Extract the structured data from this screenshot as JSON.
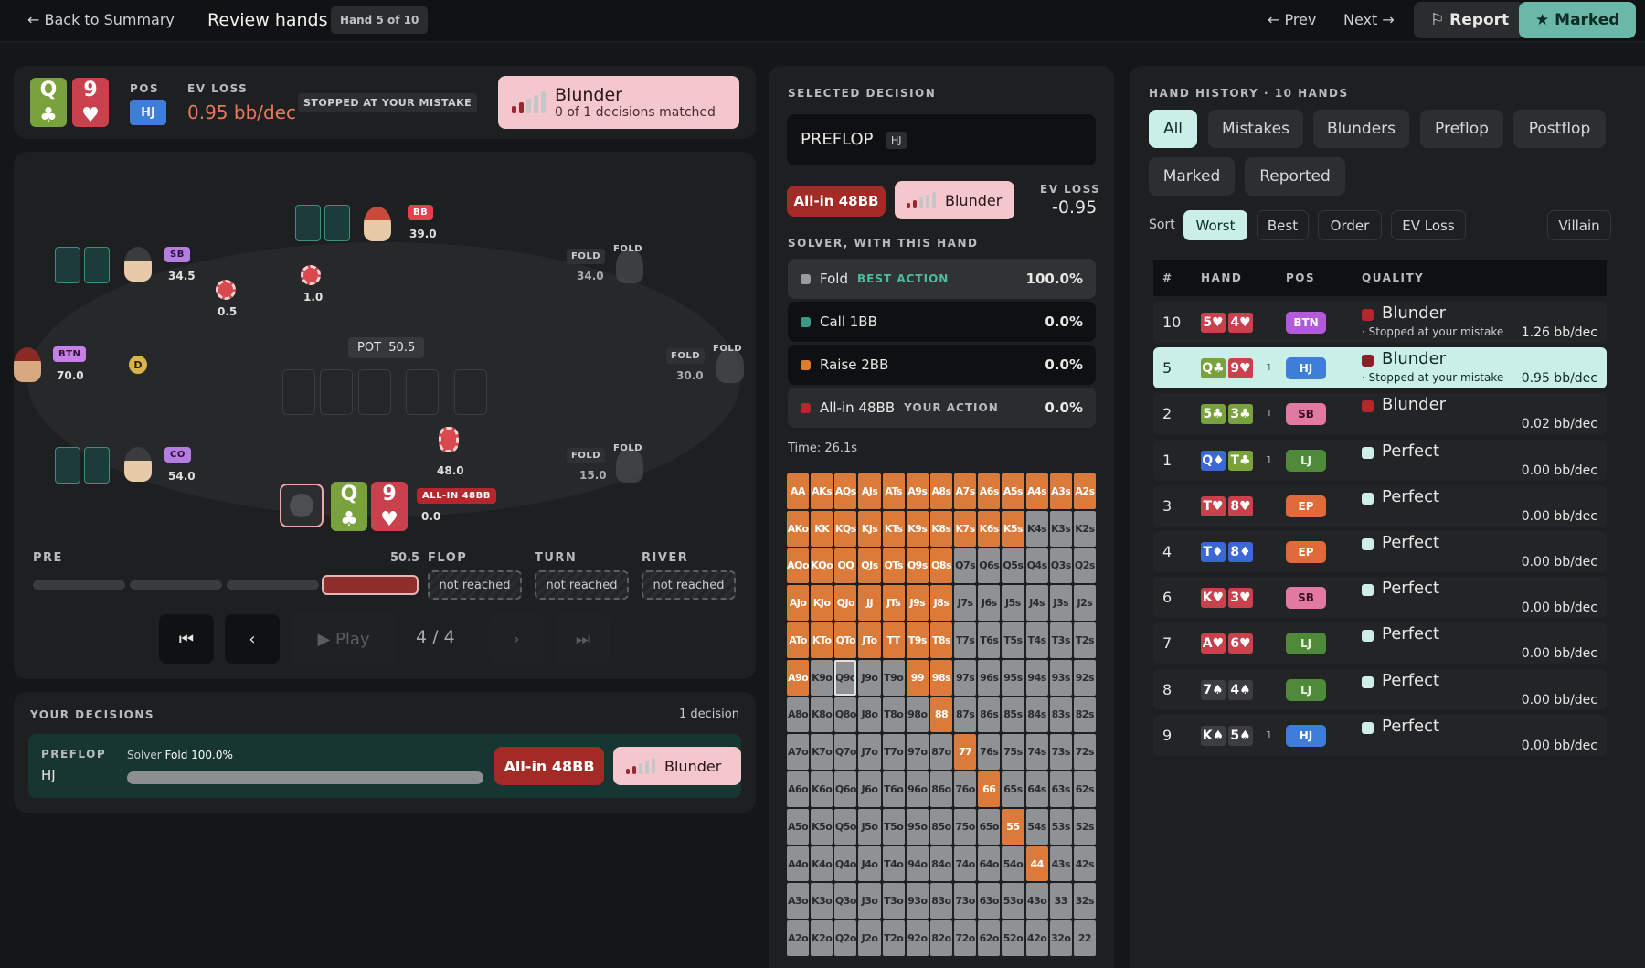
{
  "topbar": {
    "back": "← Back to Summary",
    "title": "Review hands",
    "hand_badge": "Hand 5 of 10",
    "prev": "← Prev",
    "next": "Next →",
    "report": "⚐ Report",
    "marked": "★ Marked"
  },
  "summary": {
    "cards": [
      {
        "rank": "Q",
        "suit": "♣"
      },
      {
        "rank": "9",
        "suit": "♥"
      }
    ],
    "pos_label": "POS",
    "pos_value": "HJ",
    "ev_label": "EV LOSS",
    "ev_value": "0.95 bb/dec",
    "stopped": "STOPPED AT YOUR MISTAKE",
    "verdict_title": "Blunder",
    "verdict_sub": "0 of 1 decisions matched"
  },
  "table": {
    "seats": {
      "bb": {
        "label": "BB",
        "stack": "39.0"
      },
      "sb": {
        "label": "SB",
        "stack": "34.5"
      },
      "btn": {
        "label": "BTN",
        "stack": "70.0"
      },
      "co": {
        "label": "CO",
        "stack": "54.0"
      },
      "hj": {
        "label": "ALL-IN 48BB",
        "stack": "0.0"
      },
      "fold1": {
        "tag": "FOLD",
        "tag2": "FOLD",
        "stack": "34.0"
      },
      "fold2": {
        "tag": "FOLD",
        "tag2": "FOLD",
        "stack": "30.0"
      },
      "fold3": {
        "tag": "FOLD",
        "tag2": "FOLD",
        "stack": "15.0"
      }
    },
    "bets": {
      "sb": "0.5",
      "bb": "1.0",
      "hero": "48.0"
    },
    "dealer": "D",
    "pot": "POT  50.5",
    "hero_cards": [
      {
        "rank": "Q",
        "suit": "♣"
      },
      {
        "rank": "9",
        "suit": "♥"
      }
    ]
  },
  "streets": {
    "pre": "PRE",
    "pre_value": "50.5",
    "flop": "FLOP",
    "turn": "TURN",
    "river": "RIVER",
    "not_reached": "not reached"
  },
  "controls": {
    "first": "⏮",
    "back": "‹",
    "play": "▶ Play",
    "counter": "4 / 4",
    "fwd": "›",
    "last": "⏭"
  },
  "decisions": {
    "title": "YOUR DECISIONS",
    "count": "1 decision",
    "street": "PREFLOP",
    "pos": "HJ",
    "solver_prefix": "Solver",
    "solver_action": "Fold 100.0%",
    "action": "All-in 48BB",
    "verdict": "Blunder"
  },
  "selected": {
    "title": "SELECTED DECISION",
    "street": "PREFLOP",
    "pos": "HJ",
    "action": "All-in 48BB",
    "verdict": "Blunder",
    "ev_label": "EV LOSS",
    "ev_value": "-0.95",
    "solver_title": "SOLVER, WITH THIS HAND",
    "solver_rows": [
      {
        "name": "Fold",
        "tag": "BEST ACTION",
        "pct": "100.0%",
        "color": "#9a9c9e"
      },
      {
        "name": "Call 1BB",
        "tag": "",
        "pct": "0.0%",
        "color": "#3a9a85"
      },
      {
        "name": "Raise 2BB",
        "tag": "",
        "pct": "0.0%",
        "color": "#e07a2c"
      },
      {
        "name": "All-in 48BB",
        "tag": "YOUR ACTION",
        "pct": "0.0%",
        "color": "#b8262d"
      }
    ],
    "time": "Time: 26.1s"
  },
  "range_grid": [
    [
      "AA",
      "AKs",
      "AQs",
      "AJs",
      "ATs",
      "A9s",
      "A8s",
      "A7s",
      "A6s",
      "A5s",
      "A4s",
      "A3s",
      "A2s"
    ],
    [
      "AKo",
      "KK",
      "KQs",
      "KJs",
      "KTs",
      "K9s",
      "K8s",
      "K7s",
      "K6s",
      "K5s",
      "K4s",
      "K3s",
      "K2s"
    ],
    [
      "AQo",
      "KQo",
      "QQ",
      "QJs",
      "QTs",
      "Q9s",
      "Q8s",
      "Q7s",
      "Q6s",
      "Q5s",
      "Q4s",
      "Q3s",
      "Q2s"
    ],
    [
      "AJo",
      "KJo",
      "QJo",
      "JJ",
      "JTs",
      "J9s",
      "J8s",
      "J7s",
      "J6s",
      "J5s",
      "J4s",
      "J3s",
      "J2s"
    ],
    [
      "ATo",
      "KTo",
      "QTo",
      "JTo",
      "TT",
      "T9s",
      "T8s",
      "T7s",
      "T6s",
      "T5s",
      "T4s",
      "T3s",
      "T2s"
    ],
    [
      "A9o",
      "K9o",
      "Q9o",
      "J9o",
      "T9o",
      "99",
      "98s",
      "97s",
      "96s",
      "95s",
      "94s",
      "93s",
      "92s"
    ],
    [
      "A8o",
      "K8o",
      "Q8o",
      "J8o",
      "T8o",
      "98o",
      "88",
      "87s",
      "86s",
      "85s",
      "84s",
      "83s",
      "82s"
    ],
    [
      "A7o",
      "K7o",
      "Q7o",
      "J7o",
      "T7o",
      "97o",
      "87o",
      "77",
      "76s",
      "75s",
      "74s",
      "73s",
      "72s"
    ],
    [
      "A6o",
      "K6o",
      "Q6o",
      "J6o",
      "T6o",
      "96o",
      "86o",
      "76o",
      "66",
      "65s",
      "64s",
      "63s",
      "62s"
    ],
    [
      "A5o",
      "K5o",
      "Q5o",
      "J5o",
      "T5o",
      "95o",
      "85o",
      "75o",
      "65o",
      "55",
      "54s",
      "53s",
      "52s"
    ],
    [
      "A4o",
      "K4o",
      "Q4o",
      "J4o",
      "T4o",
      "94o",
      "84o",
      "74o",
      "64o",
      "54o",
      "44",
      "43s",
      "42s"
    ],
    [
      "A3o",
      "K3o",
      "Q3o",
      "J3o",
      "T3o",
      "93o",
      "83o",
      "73o",
      "63o",
      "53o",
      "43o",
      "33",
      "32s"
    ],
    [
      "A2o",
      "K2o",
      "Q2o",
      "J2o",
      "T2o",
      "92o",
      "82o",
      "72o",
      "62o",
      "52o",
      "42o",
      "32o",
      "22"
    ]
  ],
  "range_colors": [
    "ooooooooooooo",
    "oooooooooogg",
    "oooooooggggg",
    "ooooooogggggg",
    "oooooooggggg",
    "oxgoogggggggg",
    "ggggggoggggggg",
    "gggggggoggggg",
    "ggggggggogggg",
    "gggggggggoggg",
    "ggggggggggogg",
    "ggggggggggggg",
    "ggggggggggggg"
  ],
  "history": {
    "title": "HAND HISTORY · 10 HANDS",
    "filters": [
      "All",
      "Mistakes",
      "Blunders",
      "Preflop",
      "Postflop",
      "Marked",
      "Reported"
    ],
    "sort_label": "Sort",
    "sorts": [
      "Worst",
      "Best",
      "Order",
      "EV Loss"
    ],
    "villain": "Villain",
    "cols": {
      "num": "#",
      "hand": "HAND",
      "pos": "POS",
      "quality": "QUALITY"
    },
    "rows": [
      {
        "num": "10",
        "c1": "5♥",
        "s1": "heart",
        "c2": "4♥",
        "s2": "heart",
        "tick": "",
        "pos": "BTN",
        "posColor": "#b25ad8",
        "posText": "#fff",
        "quality": "Blunder",
        "qColor": "#b8262d",
        "sub": "· Stopped at your mistake",
        "ev": "1.26 bb/dec"
      },
      {
        "num": "5",
        "c1": "Q♣",
        "s1": "club",
        "c2": "9♥",
        "s2": "heart",
        "tick": "˥",
        "pos": "HJ",
        "posColor": "#3e7ed6",
        "posText": "#fff",
        "quality": "Blunder",
        "qColor": "#8b1e26",
        "sub": "· Stopped at your mistake",
        "ev": "0.95 bb/dec"
      },
      {
        "num": "2",
        "c1": "5♣",
        "s1": "club",
        "c2": "3♣",
        "s2": "club",
        "tick": "˥",
        "pos": "SB",
        "posColor": "#e07aa3",
        "posText": "#3a1020",
        "quality": "Blunder",
        "qColor": "#b8262d",
        "sub": "",
        "ev": "0.02 bb/dec"
      },
      {
        "num": "1",
        "c1": "Q♦",
        "s1": "diamond",
        "c2": "T♣",
        "s2": "club",
        "tick": "˥",
        "pos": "LJ",
        "posColor": "#4e8a3a",
        "posText": "#e8f5df",
        "quality": "Perfect",
        "qColor": "#cfeee7",
        "sub": "",
        "ev": "0.00 bb/dec"
      },
      {
        "num": "3",
        "c1": "T♥",
        "s1": "heart",
        "c2": "8♥",
        "s2": "heart",
        "tick": "",
        "pos": "EP",
        "posColor": "#e06a3a",
        "posText": "#fff",
        "quality": "Perfect",
        "qColor": "#cfeee7",
        "sub": "",
        "ev": "0.00 bb/dec"
      },
      {
        "num": "4",
        "c1": "T♦",
        "s1": "diamond",
        "c2": "8♦",
        "s2": "diamond",
        "tick": "",
        "pos": "EP",
        "posColor": "#e06a3a",
        "posText": "#fff",
        "quality": "Perfect",
        "qColor": "#cfeee7",
        "sub": "",
        "ev": "0.00 bb/dec"
      },
      {
        "num": "6",
        "c1": "K♥",
        "s1": "heart",
        "c2": "3♥",
        "s2": "heart",
        "tick": "",
        "pos": "SB",
        "posColor": "#e07aa3",
        "posText": "#3a1020",
        "quality": "Perfect",
        "qColor": "#cfeee7",
        "sub": "",
        "ev": "0.00 bb/dec"
      },
      {
        "num": "7",
        "c1": "A♥",
        "s1": "heart",
        "c2": "6♥",
        "s2": "heart",
        "tick": "",
        "pos": "LJ",
        "posColor": "#4e8a3a",
        "posText": "#e8f5df",
        "quality": "Perfect",
        "qColor": "#cfeee7",
        "sub": "",
        "ev": "0.00 bb/dec"
      },
      {
        "num": "8",
        "c1": "7♠",
        "s1": "spade",
        "c2": "4♠",
        "s2": "spade",
        "tick": "",
        "pos": "LJ",
        "posColor": "#4e8a3a",
        "posText": "#e8f5df",
        "quality": "Perfect",
        "qColor": "#cfeee7",
        "sub": "",
        "ev": "0.00 bb/dec"
      },
      {
        "num": "9",
        "c1": "K♠",
        "s1": "spade",
        "c2": "5♠",
        "s2": "spade",
        "tick": "˥",
        "pos": "HJ",
        "posColor": "#3e7ed6",
        "posText": "#fff",
        "quality": "Perfect",
        "qColor": "#cfeee7",
        "sub": "",
        "ev": "0.00 bb/dec"
      }
    ]
  }
}
